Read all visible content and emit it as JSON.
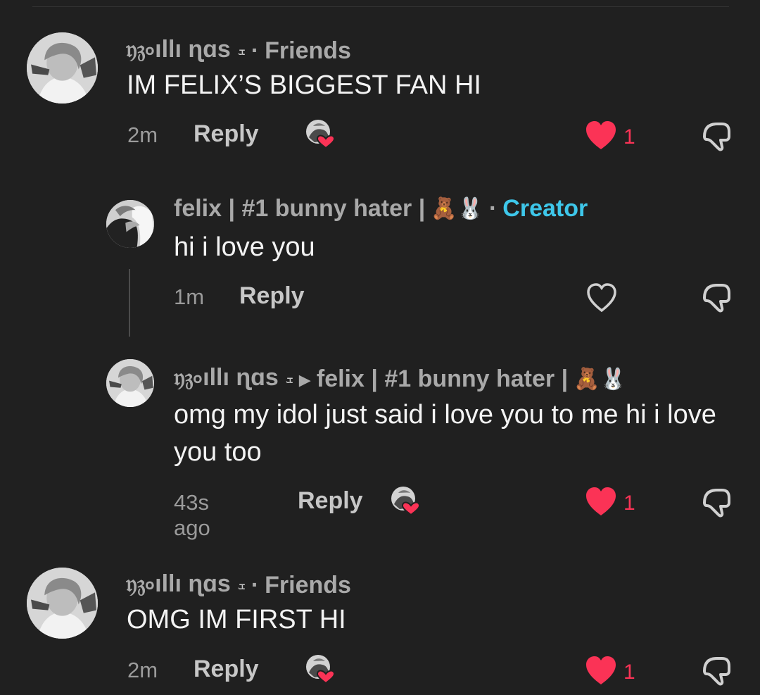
{
  "comments": [
    {
      "author": "𝔶𝔷৹ıllı ɳɑs",
      "mark": "ܫ",
      "separator": "·",
      "badge": "Friends",
      "text": "IM FELIX’S BIGGEST FAN HI",
      "time": "2m",
      "reply_label": "Reply",
      "likes": "1",
      "liked": true,
      "creator_liked": true
    },
    {
      "author": "felix | #1 bunny hater |",
      "emojis": "🧸🐰",
      "separator": "·",
      "badge": "Creator",
      "text": "hi i love you",
      "time": "1m",
      "reply_label": "Reply",
      "likes": "",
      "liked": false,
      "creator_liked": false
    },
    {
      "author": "𝔶𝔷৹ıllı ɳɑs",
      "mark": "ܫ",
      "reply_arrow": "▸",
      "reply_to": "felix | #1 bunny hater |",
      "emojis": "🧸🐰",
      "text": "omg my idol just said i love you to me hi i love you too",
      "time": "43s ago",
      "reply_label": "Reply",
      "likes": "1",
      "liked": true,
      "creator_liked": true
    },
    {
      "author": "𝔶𝔷৹ıllı ɳɑs",
      "mark": "ܫ",
      "separator": "·",
      "badge": "Friends",
      "text": "OMG IM FIRST HI",
      "time": "2m",
      "reply_label": "Reply",
      "likes": "1",
      "liked": true,
      "creator_liked": true
    }
  ],
  "colors": {
    "background": "#202020",
    "like_red": "#fb3356",
    "creator_blue": "#3ec7ea",
    "secondary_text": "#a9a9a9"
  },
  "icons": {
    "like": "heart-icon",
    "dislike": "thumbs-down-icon",
    "creator_liked": "creator-liked-heart-icon"
  }
}
